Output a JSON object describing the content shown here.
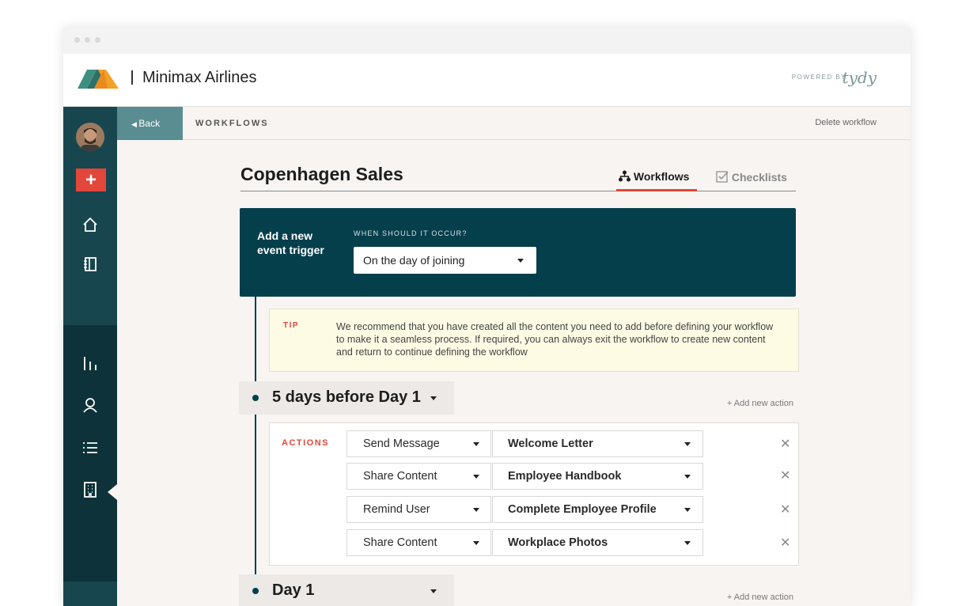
{
  "app": {
    "brand": "Minimax Airlines",
    "powered_by": "POWERED BY",
    "powered_logo": "tydy",
    "colors": {
      "accent": "#e3463a",
      "sidebar": "#18464f",
      "panel": "#063f4c",
      "back": "#5a8d92"
    }
  },
  "sidebar": {
    "items": [
      {
        "icon": "avatar"
      },
      {
        "icon": "plus-icon"
      },
      {
        "icon": "home-icon"
      },
      {
        "icon": "notebook-icon"
      },
      {
        "icon": "bar-chart-icon"
      },
      {
        "icon": "user-icon"
      },
      {
        "icon": "list-icon"
      },
      {
        "icon": "building-icon"
      }
    ]
  },
  "subbar": {
    "back": "Back",
    "crumb": "WORKFLOWS",
    "delete": "Delete workflow"
  },
  "main": {
    "title": "Copenhagen Sales",
    "tabs": [
      {
        "label": "Workflows",
        "icon": "workflow-icon",
        "active": true
      },
      {
        "label": "Checklists",
        "icon": "checkbox-icon",
        "active": false
      }
    ],
    "trigger": {
      "label": "Add a new event trigger",
      "when_label": "WHEN SHOULD IT OCCUR?",
      "when_value": "On the day of joining"
    },
    "tip": {
      "label": "TIP",
      "text": "We recommend that you have created all the content you need to add before defining your workflow to make it a seamless process. If required, you can always exit the workflow to create new content and return to continue defining the workflow"
    },
    "sections": [
      {
        "label": "5 days before Day 1",
        "add_action": "+ Add new action",
        "actions_label": "ACTIONS",
        "actions": [
          {
            "type": "Send Message",
            "target": "Welcome Letter"
          },
          {
            "type": "Share Content",
            "target": "Employee Handbook"
          },
          {
            "type": "Remind User",
            "target": "Complete Employee Profile"
          },
          {
            "type": "Share Content",
            "target": "Workplace Photos"
          }
        ]
      },
      {
        "label": "Day 1",
        "add_action": "+ Add new action"
      }
    ]
  }
}
